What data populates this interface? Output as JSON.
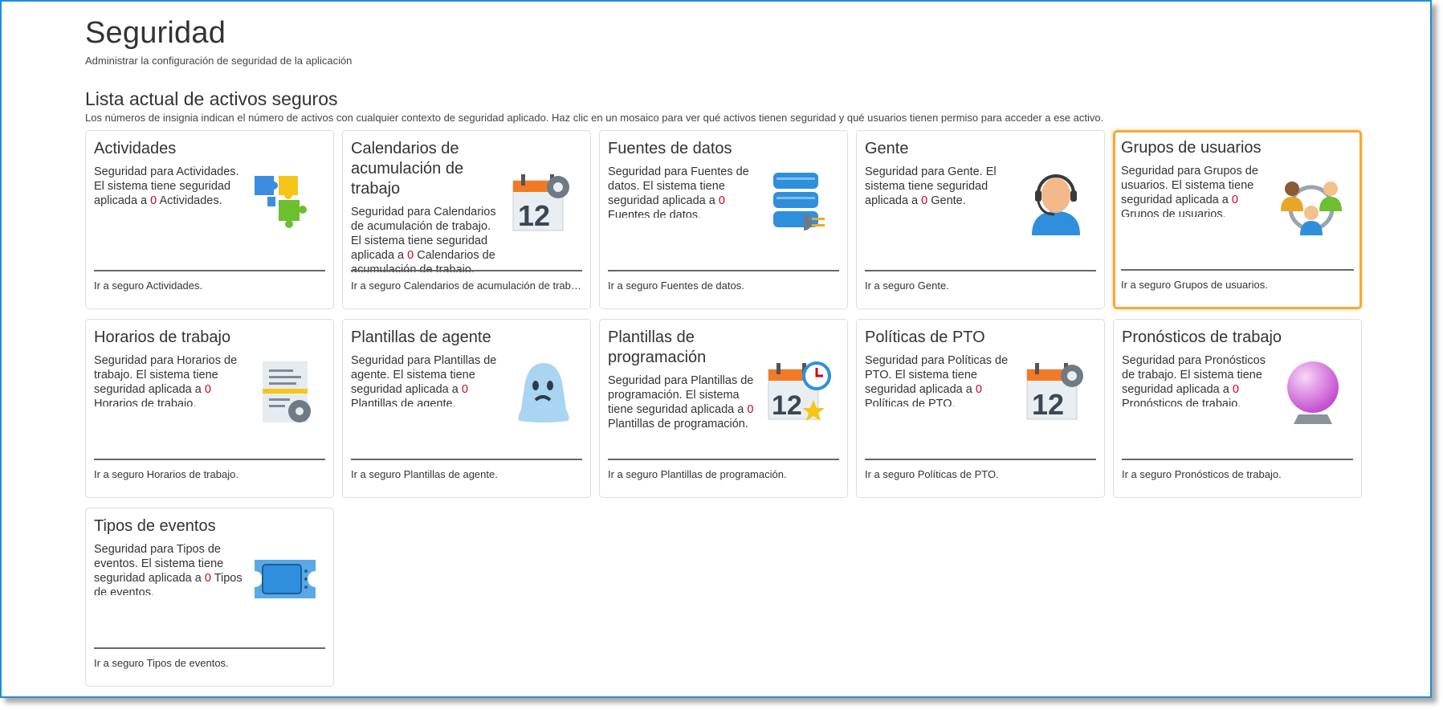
{
  "page": {
    "title": "Seguridad",
    "subtitle": "Administrar la configuración de seguridad de la aplicación",
    "section_title": "Lista actual de activos seguros",
    "section_desc": "Los números de insignia indican el número de activos con cualquier contexto de seguridad aplicado. Haz clic en un mosaico para ver qué activos tienen seguridad y qué usuarios tienen permiso para acceder a ese activo."
  },
  "tiles": [
    {
      "title": "Actividades",
      "body_pre": "Seguridad para Actividades.  El sistema tiene seguridad aplicada a ",
      "count": "0",
      "body_post": " Actividades.",
      "link": "Ir a seguro Actividades.",
      "icon": "puzzle-icon"
    },
    {
      "title": "Calendarios de acumulación de trabajo",
      "body_pre": "Seguridad para Calendarios de acumulación de trabajo.  El sistema tiene seguridad aplicada a ",
      "count": "0",
      "body_post": " Calendarios de acumulación de trabajo.",
      "link": "Ir a seguro Calendarios de acumulación de trabajo.",
      "icon": "calendar-gear-icon"
    },
    {
      "title": "Fuentes de datos",
      "body_pre": "Seguridad para Fuentes de datos.  El sistema tiene seguridad aplicada a ",
      "count": "0",
      "body_post": " Fuentes de datos.",
      "link": "Ir a seguro Fuentes de datos.",
      "icon": "database-plug-icon"
    },
    {
      "title": "Gente",
      "body_pre": "Seguridad para Gente.  El sistema tiene seguridad aplicada a ",
      "count": "0",
      "body_post": " Gente.",
      "link": "Ir a seguro Gente.",
      "icon": "headset-person-icon"
    },
    {
      "title": "Grupos de usuarios",
      "body_pre": "Seguridad para Grupos de usuarios.  El sistema tiene seguridad aplicada a ",
      "count": "0",
      "body_post": " Grupos de usuarios.",
      "link": "Ir a seguro Grupos de usuarios.",
      "icon": "user-group-icon"
    },
    {
      "title": "Horarios de trabajo",
      "body_pre": "Seguridad para Horarios de trabajo.  El sistema tiene seguridad aplicada a ",
      "count": "0",
      "body_post": " Horarios de trabajo.",
      "link": "Ir a seguro Horarios de trabajo.",
      "icon": "schedule-gear-icon"
    },
    {
      "title": "Plantillas de agente",
      "body_pre": "Seguridad para Plantillas de agente.  El sistema tiene seguridad aplicada a ",
      "count": "0",
      "body_post": " Plantillas de agente.",
      "link": "Ir a seguro Plantillas de agente.",
      "icon": "ghost-icon"
    },
    {
      "title": "Plantillas de programación",
      "body_pre": "Seguridad para Plantillas de programación.  El sistema tiene seguridad aplicada a ",
      "count": "0",
      "body_post": " Plantillas de programación.",
      "link": "Ir a seguro Plantillas de programación.",
      "icon": "calendar-clock-icon"
    },
    {
      "title": "Políticas de PTO",
      "body_pre": "Seguridad para Políticas de PTO.  El sistema tiene seguridad aplicada a ",
      "count": "0",
      "body_post": " Políticas de PTO.",
      "link": "Ir a seguro Políticas de PTO.",
      "icon": "calendar-gear-icon"
    },
    {
      "title": "Pronósticos de trabajo",
      "body_pre": "Seguridad para Pronósticos de trabajo.  El sistema tiene seguridad aplicada a ",
      "count": "0",
      "body_post": " Pronósticos de trabajo.",
      "link": "Ir a seguro Pronósticos de trabajo.",
      "icon": "crystal-ball-icon"
    },
    {
      "title": "Tipos de eventos",
      "body_pre": "Seguridad para Tipos de eventos.  El sistema tiene seguridad aplicada a ",
      "count": "0",
      "body_post": " Tipos de eventos.",
      "link": "Ir a seguro Tipos de eventos.",
      "icon": "ticket-icon"
    }
  ],
  "selected_tile": "Grupos de usuarios",
  "colors": {
    "frame": "#1e90d6",
    "selected_border": "#f2a93b",
    "count": "#d0021b"
  }
}
